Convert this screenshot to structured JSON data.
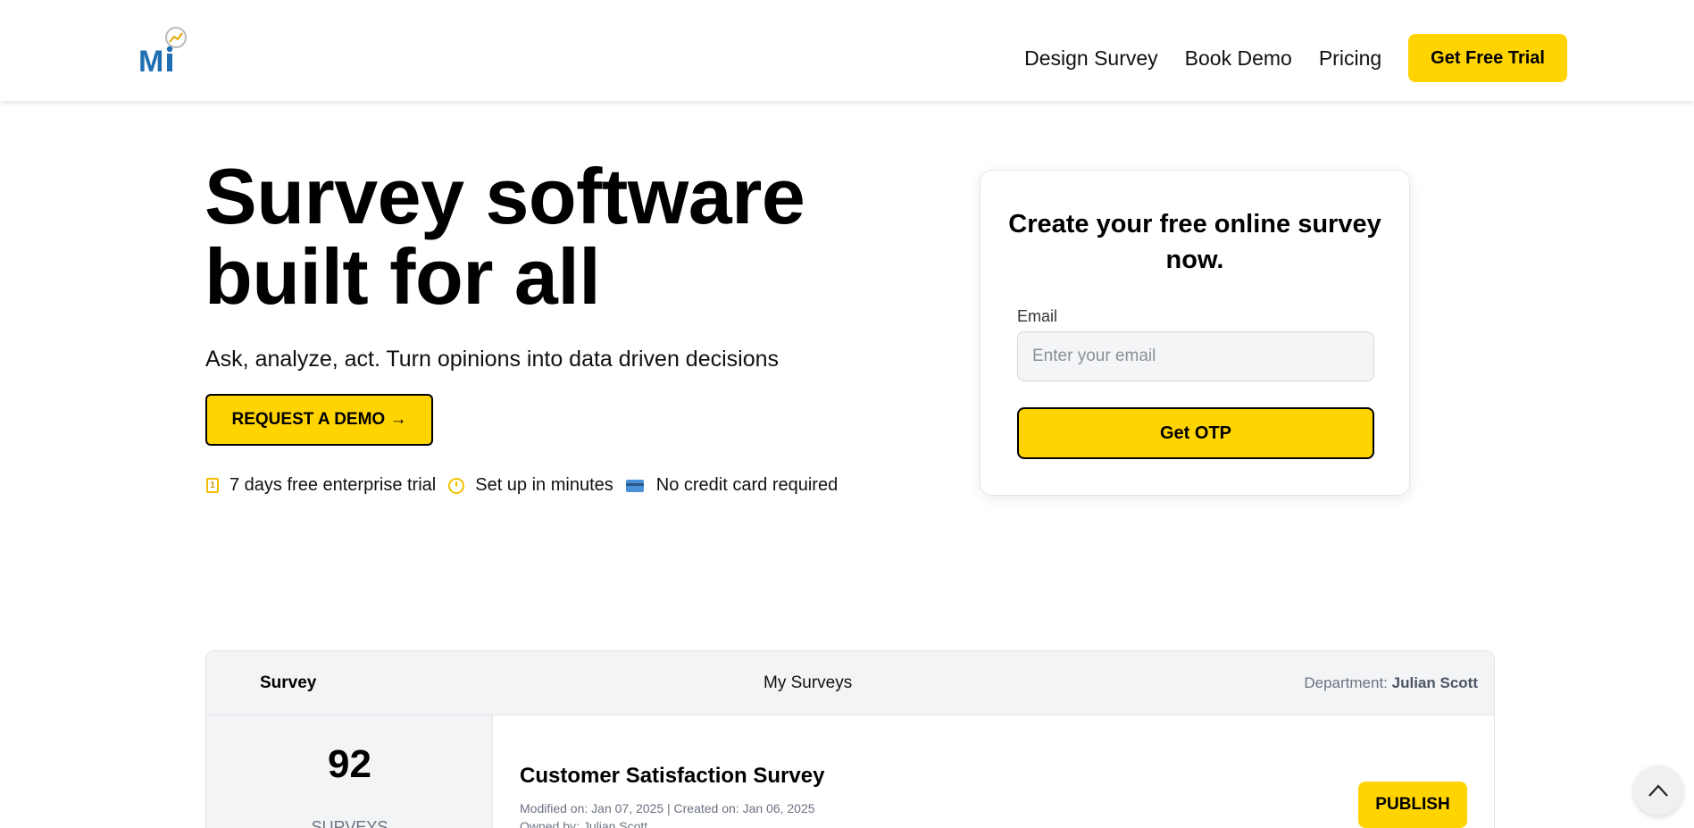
{
  "header": {
    "logo_text": "Mi",
    "nav": [
      "Design Survey",
      "Book Demo",
      "Pricing"
    ],
    "cta_label": "Get Free Trial"
  },
  "hero": {
    "title_line1": "Survey software",
    "title_line2": "built for all",
    "subtitle": "Ask, analyze, act. Turn opinions into data driven decisions",
    "demo_button": "REQUEST A DEMO →",
    "features": [
      {
        "icon": "calendar-icon",
        "label": "7 days free enterprise trial"
      },
      {
        "icon": "stopwatch-icon",
        "label": "Set up in minutes"
      },
      {
        "icon": "credit-card-icon",
        "label": "No credit card required"
      }
    ]
  },
  "signup": {
    "title": "Create your free online survey now.",
    "email_label": "Email",
    "email_placeholder": "Enter your email",
    "email_value": "",
    "submit_label": "Get OTP"
  },
  "dashboard": {
    "header_survey": "Survey",
    "header_my_surveys": "My Surveys",
    "department_label": "Department:",
    "department_value": "Julian Scott",
    "survey_count": "92",
    "survey_count_label": "SURVEYS",
    "survey_title": "Customer Satisfaction Survey",
    "survey_meta": "Modified on: Jan 07, 2025 | Created on: Jan 06, 2025",
    "survey_owner": "Owned by:  Julian Scott",
    "publish_label": "PUBLISH"
  },
  "colors": {
    "accent": "#ffd400",
    "logo_blue": "#1f6fb2"
  }
}
